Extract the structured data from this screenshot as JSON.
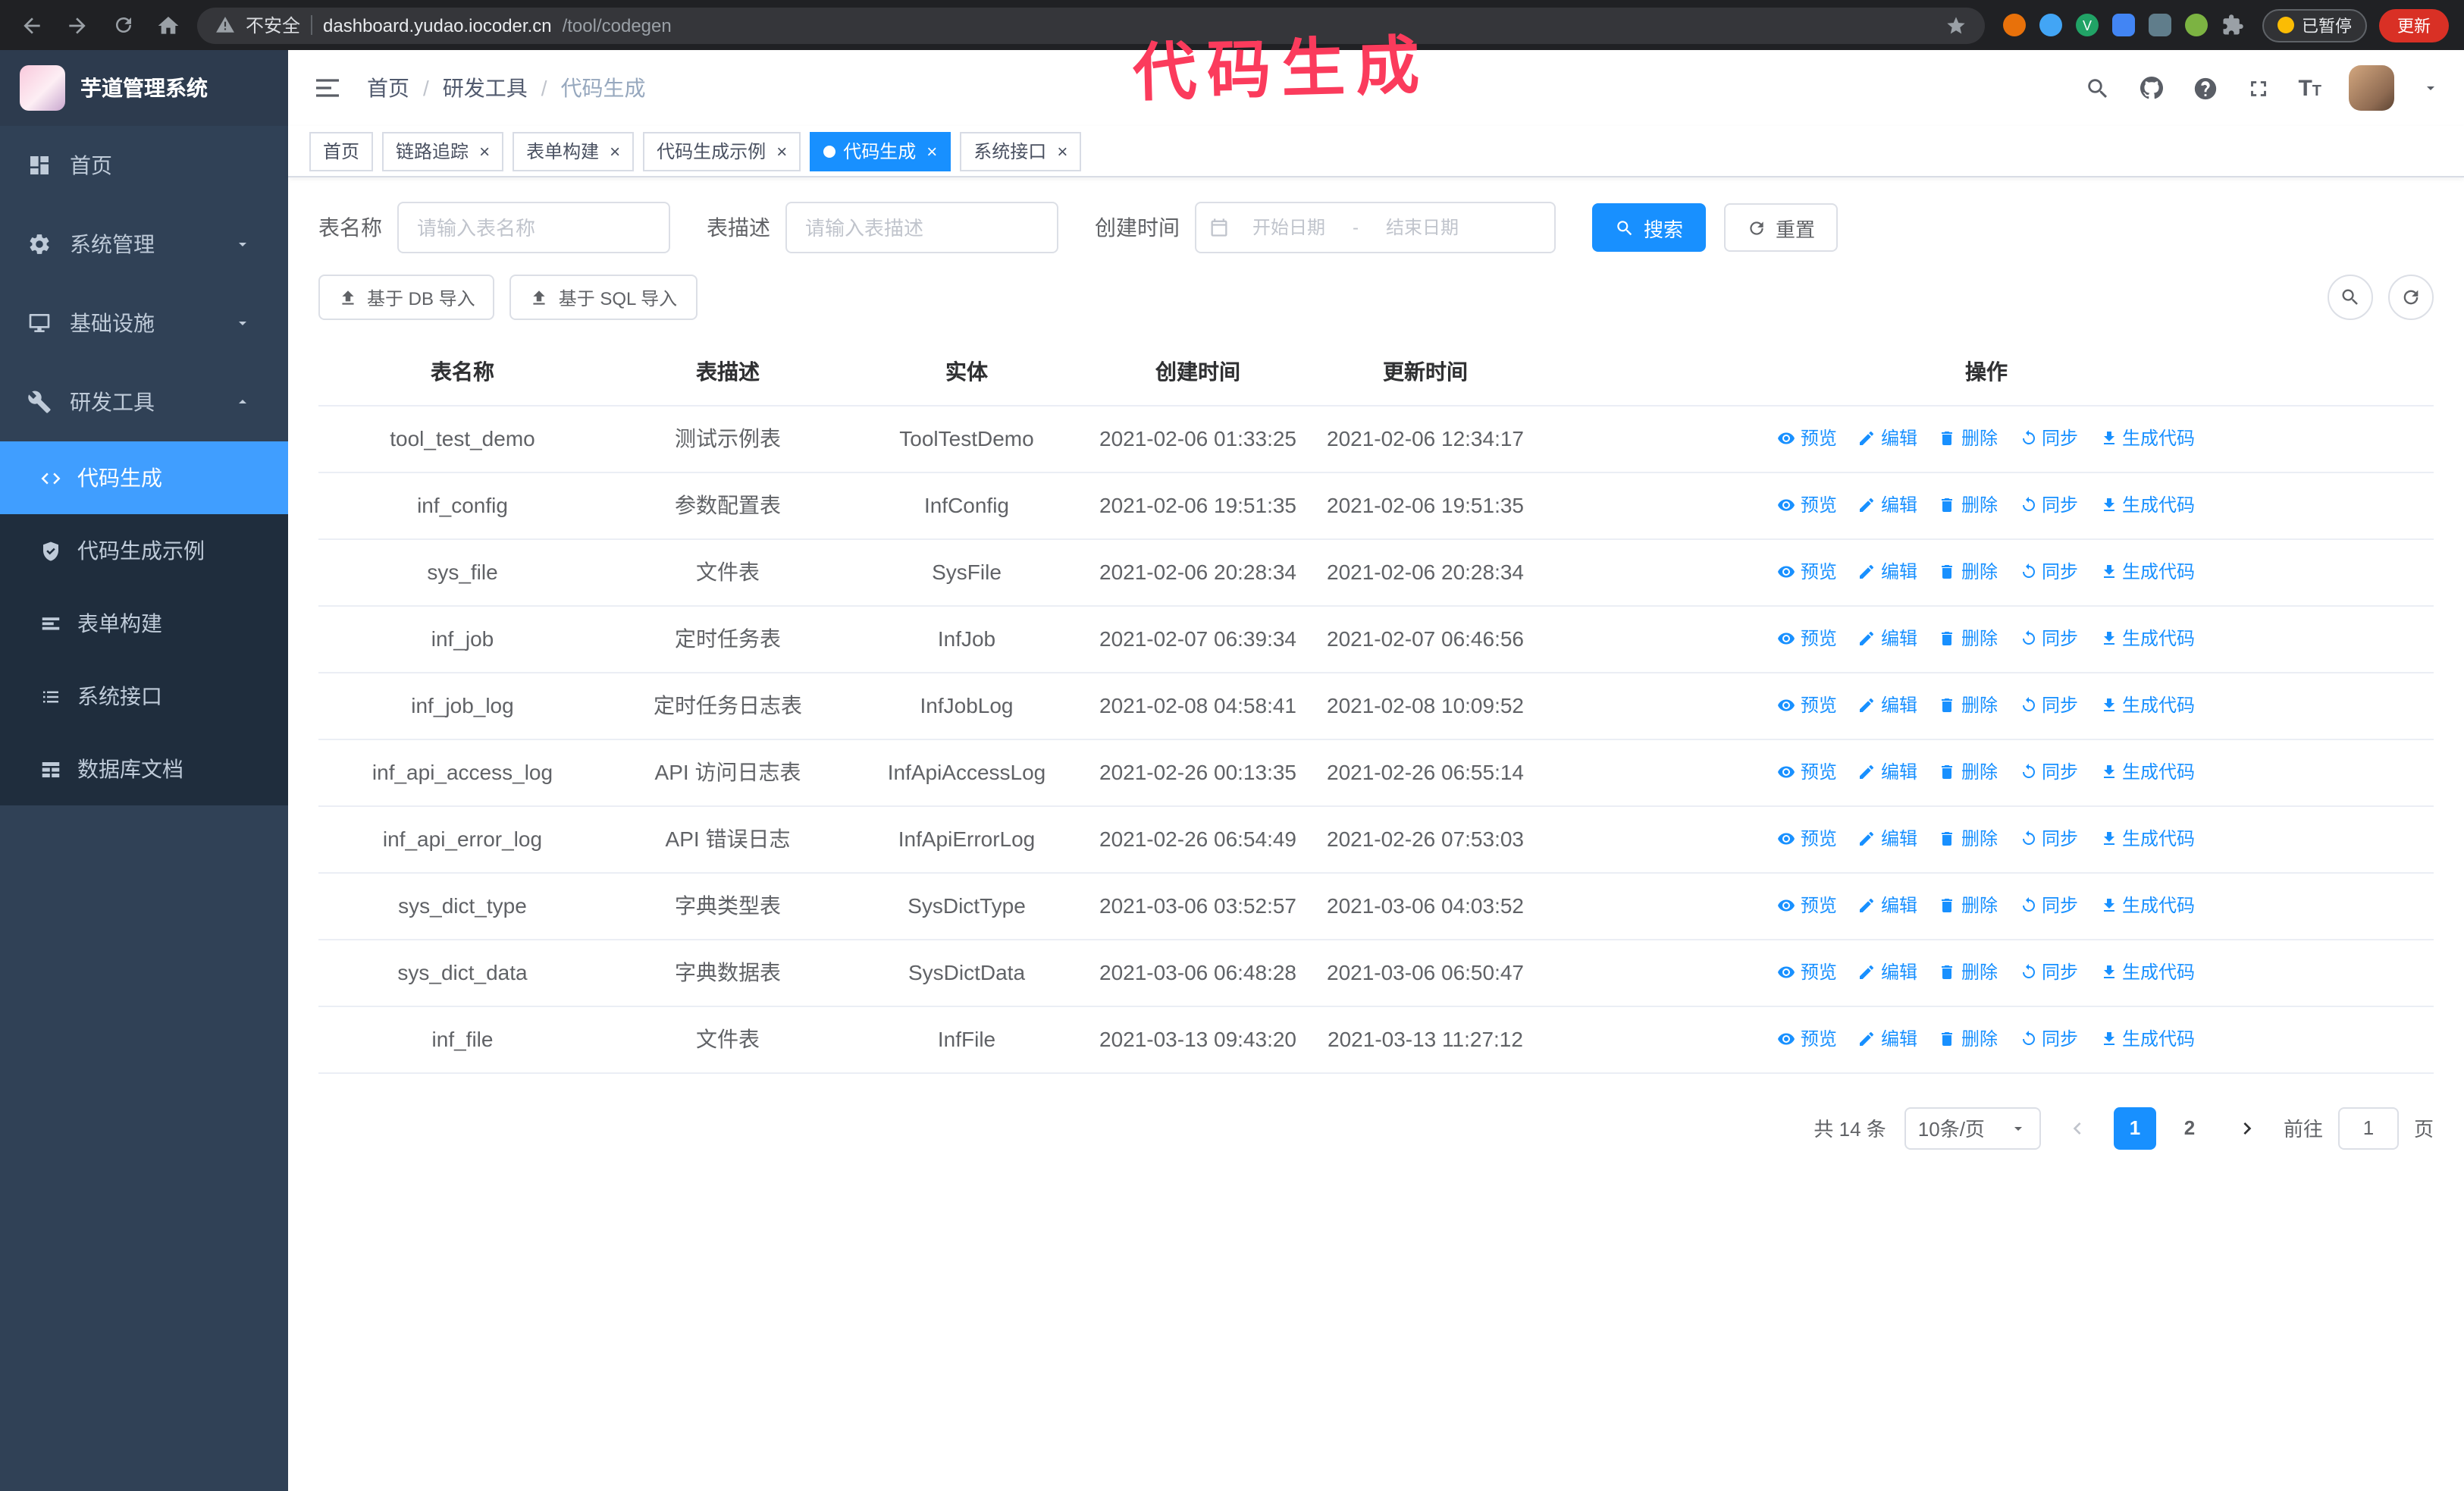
{
  "browser": {
    "security_label": "不安全",
    "url_host": "dashboard.yudao.iocoder.cn",
    "url_path": "/tool/codegen",
    "paused_badge": "已暂停",
    "update_button": "更新"
  },
  "annotation": "代码生成",
  "sidebar": {
    "logo_title": "芋道管理系统",
    "items": [
      {
        "label": "首页",
        "icon": "dashboard"
      },
      {
        "label": "系统管理",
        "icon": "gear",
        "chevron": "down"
      },
      {
        "label": "基础设施",
        "icon": "infra",
        "chevron": "down"
      },
      {
        "label": "研发工具",
        "icon": "tools",
        "chevron": "up",
        "expanded": true
      }
    ],
    "submenu": [
      {
        "label": "代码生成",
        "icon": "code",
        "active": true
      },
      {
        "label": "代码生成示例",
        "icon": "shield"
      },
      {
        "label": "表单构建",
        "icon": "form"
      },
      {
        "label": "系统接口",
        "icon": "api"
      },
      {
        "label": "数据库文档",
        "icon": "db"
      }
    ]
  },
  "navbar": {
    "breadcrumb": [
      "首页",
      "研发工具",
      "代码生成"
    ]
  },
  "tabs": [
    {
      "label": "首页",
      "closable": false,
      "active": false
    },
    {
      "label": "链路追踪",
      "closable": true,
      "active": false
    },
    {
      "label": "表单构建",
      "closable": true,
      "active": false
    },
    {
      "label": "代码生成示例",
      "closable": true,
      "active": false
    },
    {
      "label": "代码生成",
      "closable": true,
      "active": true
    },
    {
      "label": "系统接口",
      "closable": true,
      "active": false
    }
  ],
  "filters": {
    "table_name_label": "表名称",
    "table_name_placeholder": "请输入表名称",
    "table_desc_label": "表描述",
    "table_desc_placeholder": "请输入表描述",
    "create_time_label": "创建时间",
    "date_start_placeholder": "开始日期",
    "date_separator": "-",
    "date_end_placeholder": "结束日期",
    "search_button": "搜索",
    "reset_button": "重置"
  },
  "toolbar": {
    "import_db": "基于 DB 导入",
    "import_sql": "基于 SQL 导入"
  },
  "table": {
    "columns": [
      "表名称",
      "表描述",
      "实体",
      "创建时间",
      "更新时间",
      "操作"
    ],
    "actions": [
      {
        "label": "预览",
        "icon": "eye"
      },
      {
        "label": "编辑",
        "icon": "edit"
      },
      {
        "label": "删除",
        "icon": "delete"
      },
      {
        "label": "同步",
        "icon": "sync"
      },
      {
        "label": "生成代码",
        "icon": "download"
      }
    ],
    "rows": [
      {
        "name": "tool_test_demo",
        "desc": "测试示例表",
        "entity": "ToolTestDemo",
        "created": "2021-02-06 01:33:25",
        "updated": "2021-02-06 12:34:17"
      },
      {
        "name": "inf_config",
        "desc": "参数配置表",
        "entity": "InfConfig",
        "created": "2021-02-06 19:51:35",
        "updated": "2021-02-06 19:51:35"
      },
      {
        "name": "sys_file",
        "desc": "文件表",
        "entity": "SysFile",
        "created": "2021-02-06 20:28:34",
        "updated": "2021-02-06 20:28:34"
      },
      {
        "name": "inf_job",
        "desc": "定时任务表",
        "entity": "InfJob",
        "created": "2021-02-07 06:39:34",
        "updated": "2021-02-07 06:46:56"
      },
      {
        "name": "inf_job_log",
        "desc": "定时任务日志表",
        "entity": "InfJobLog",
        "created": "2021-02-08 04:58:41",
        "updated": "2021-02-08 10:09:52"
      },
      {
        "name": "inf_api_access_log",
        "desc": "API 访问日志表",
        "entity": "InfApiAccessLog",
        "created": "2021-02-26 00:13:35",
        "updated": "2021-02-26 06:55:14"
      },
      {
        "name": "inf_api_error_log",
        "desc": "API 错误日志",
        "entity": "InfApiErrorLog",
        "created": "2021-02-26 06:54:49",
        "updated": "2021-02-26 07:53:03"
      },
      {
        "name": "sys_dict_type",
        "desc": "字典类型表",
        "entity": "SysDictType",
        "created": "2021-03-06 03:52:57",
        "updated": "2021-03-06 04:03:52"
      },
      {
        "name": "sys_dict_data",
        "desc": "字典数据表",
        "entity": "SysDictData",
        "created": "2021-03-06 06:48:28",
        "updated": "2021-03-06 06:50:47"
      },
      {
        "name": "inf_file",
        "desc": "文件表",
        "entity": "InfFile",
        "created": "2021-03-13 09:43:20",
        "updated": "2021-03-13 11:27:12"
      }
    ]
  },
  "pagination": {
    "total_text": "共 14 条",
    "page_size": "10条/页",
    "pages": [
      "1",
      "2"
    ],
    "active_page": "1",
    "goto_label": "前往",
    "goto_value": "1",
    "goto_unit": "页"
  }
}
